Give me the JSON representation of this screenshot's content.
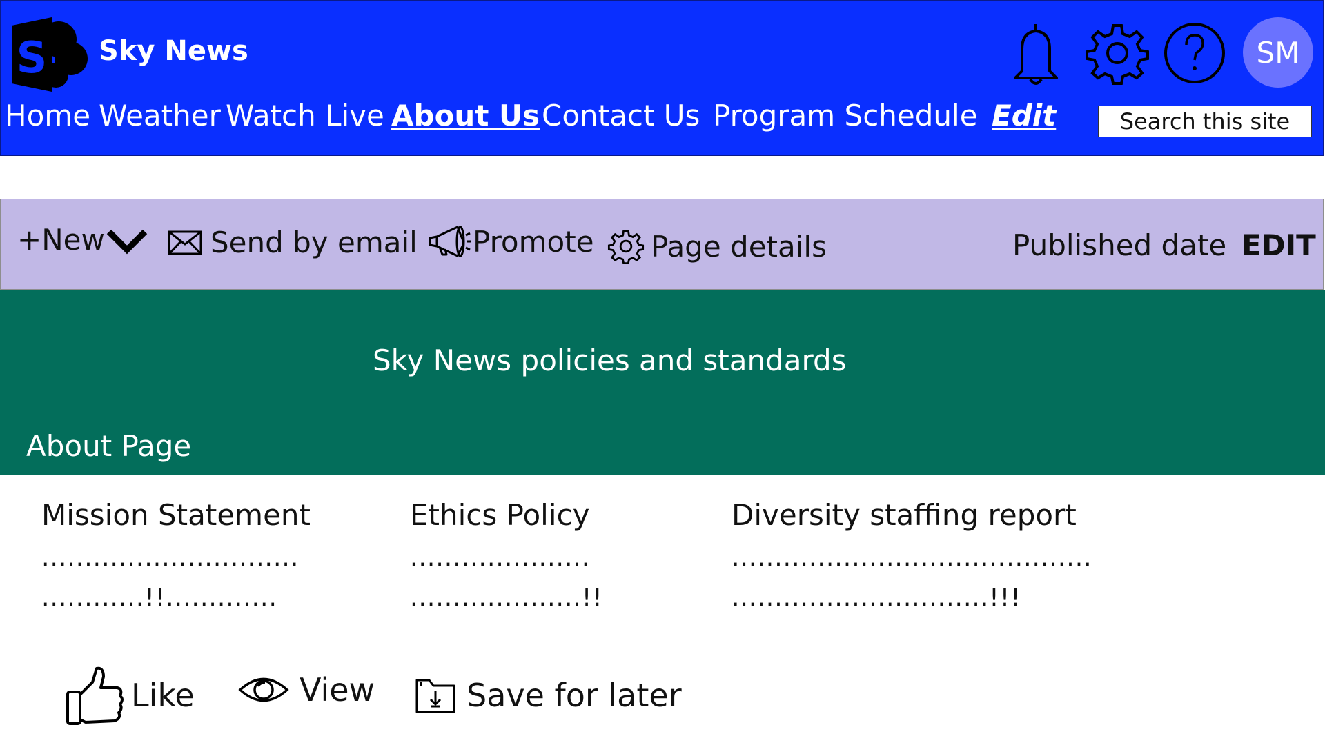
{
  "header": {
    "site_title": "Sky News",
    "nav": [
      "Home",
      "Weather",
      "Watch Live",
      "About Us",
      "Contact Us",
      "Program Schedule",
      "Edit"
    ],
    "active_nav": "About Us",
    "search_placeholder": "Search this site",
    "avatar_initials": "SM",
    "icons": [
      "sharepoint-logo-icon",
      "bell-icon",
      "gear-icon",
      "help-icon"
    ],
    "colors": {
      "header_bg": "#0a2fff",
      "avatar_bg": "#6a72ff"
    }
  },
  "command_bar": {
    "new_label": "+New",
    "send_email_label": "Send by email",
    "promote_label": "Promote",
    "page_details_label": "Page details",
    "published_label": "Published date",
    "edit_label": "EDIT",
    "colors": {
      "bg": "#c1b8e6"
    }
  },
  "banner": {
    "subtitle": "Sky News policies and standards",
    "title": "About Page",
    "colors": {
      "bg": "#036e5b"
    }
  },
  "columns": [
    {
      "title": "Mission Statement",
      "line1": "..............................",
      "line2": "............!!............."
    },
    {
      "title": "Ethics Policy",
      "line1": ".....................",
      "line2": "....................!!"
    },
    {
      "title": "Diversity staffing report",
      "line1": "..........................................",
      "line2": "..............................!!!"
    }
  ],
  "actions": {
    "like_label": "Like",
    "view_label": "View",
    "save_label": "Save for later"
  }
}
